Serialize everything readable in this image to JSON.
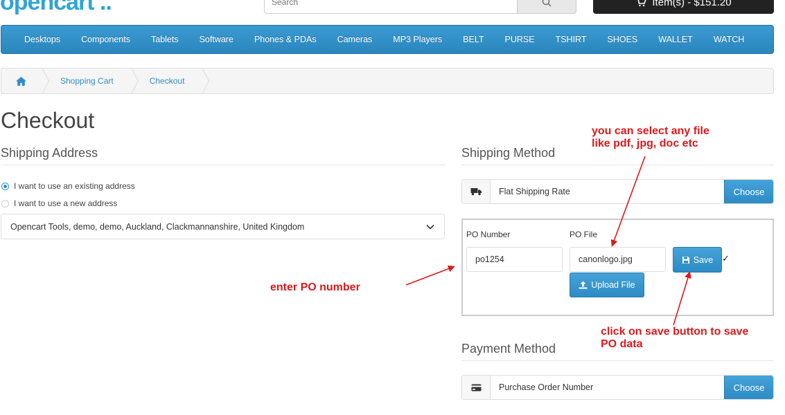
{
  "header": {
    "logo_text": "opencart",
    "logo_dots": "..",
    "search_placeholder": "Search",
    "cart_label": "Item(s) - $151.20"
  },
  "menu": {
    "items": [
      "Desktops",
      "Components",
      "Tablets",
      "Software",
      "Phones & PDAs",
      "Cameras",
      "MP3 Players",
      "BELT",
      "PURSE",
      "TSHIRT",
      "SHOES",
      "WALLET",
      "WATCH"
    ]
  },
  "breadcrumb": {
    "items": [
      "Shopping Cart",
      "Checkout"
    ]
  },
  "page": {
    "title": "Checkout"
  },
  "shipping_address": {
    "title": "Shipping Address",
    "option_existing": "I want to use an existing address",
    "option_new": "I want to use a new address",
    "selected_address": "Opencart Tools, demo, demo, Auckland, Clackmannanshire, United Kingdom"
  },
  "shipping_method": {
    "title": "Shipping Method",
    "selected": "Flat Shipping Rate",
    "choose_label": "Choose"
  },
  "po": {
    "number_label": "PO Number",
    "number_value": "po1254",
    "file_label": "PO File",
    "file_value": "canonlogo.jpg",
    "save_label": "Save",
    "upload_label": "Upload File",
    "saved_mark": "✓"
  },
  "payment_method": {
    "title": "Payment Method",
    "selected": "Purchase Order Number",
    "choose_label": "Choose"
  },
  "annotations": {
    "file_note_line1": "you can select any file",
    "file_note_line2": "like pdf, jpg, doc etc",
    "po_note": "enter PO number",
    "save_note_line1": "click on save button to save",
    "save_note_line2": "PO data"
  },
  "colors": {
    "accent": "#2f8fca",
    "annotation": "#e0181b",
    "menu_bg": "#3a9bd2"
  }
}
